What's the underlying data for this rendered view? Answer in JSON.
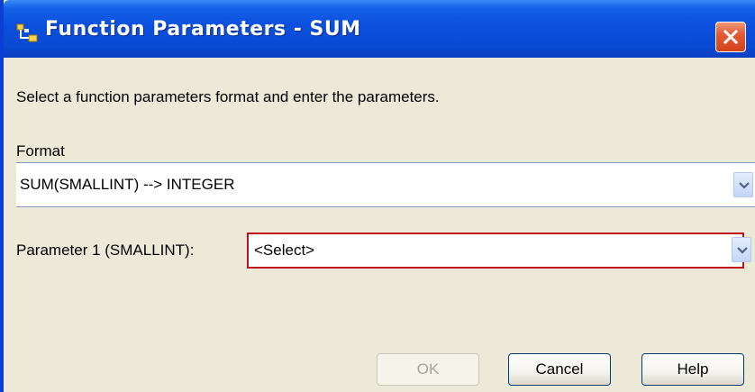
{
  "window": {
    "title": "Function Parameters - SUM",
    "icon": "function-icon",
    "close": "close-icon"
  },
  "instruction": "Select a function parameters format and enter the parameters.",
  "format": {
    "label": "Format",
    "value": "SUM(SMALLINT) -->  INTEGER",
    "dropdown_icon": "chevron-down-icon"
  },
  "parameter1": {
    "label": "Parameter 1 (SMALLINT):",
    "value": "<Select>",
    "dropdown_icon": "chevron-down-icon"
  },
  "buttons": {
    "ok": "OK",
    "cancel": "Cancel",
    "help": "Help"
  },
  "colors": {
    "titlebar": "#0a4fdd",
    "dialog_bg": "#ece9d8",
    "invalid_border": "#c0141c",
    "close_button": "#e45a35"
  }
}
